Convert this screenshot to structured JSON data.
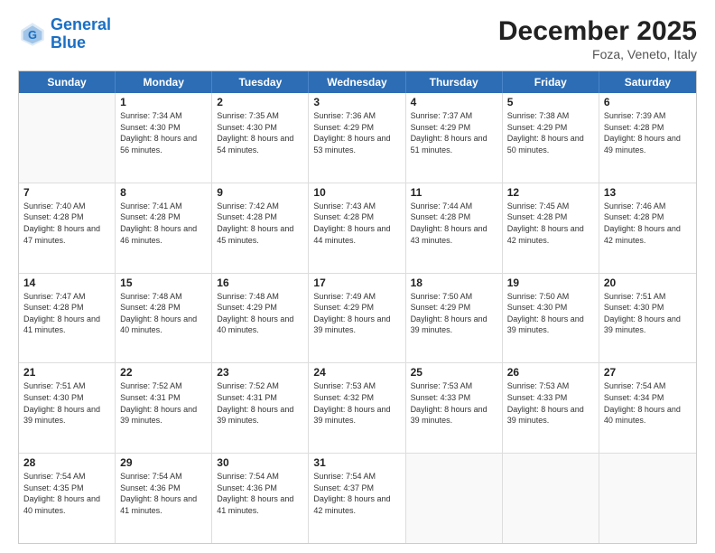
{
  "header": {
    "logo_line1": "General",
    "logo_line2": "Blue",
    "main_title": "December 2025",
    "subtitle": "Foza, Veneto, Italy"
  },
  "day_headers": [
    "Sunday",
    "Monday",
    "Tuesday",
    "Wednesday",
    "Thursday",
    "Friday",
    "Saturday"
  ],
  "rows": [
    [
      {
        "day": "",
        "empty": true
      },
      {
        "day": "1",
        "sunrise": "Sunrise: 7:34 AM",
        "sunset": "Sunset: 4:30 PM",
        "daylight": "Daylight: 8 hours and 56 minutes."
      },
      {
        "day": "2",
        "sunrise": "Sunrise: 7:35 AM",
        "sunset": "Sunset: 4:30 PM",
        "daylight": "Daylight: 8 hours and 54 minutes."
      },
      {
        "day": "3",
        "sunrise": "Sunrise: 7:36 AM",
        "sunset": "Sunset: 4:29 PM",
        "daylight": "Daylight: 8 hours and 53 minutes."
      },
      {
        "day": "4",
        "sunrise": "Sunrise: 7:37 AM",
        "sunset": "Sunset: 4:29 PM",
        "daylight": "Daylight: 8 hours and 51 minutes."
      },
      {
        "day": "5",
        "sunrise": "Sunrise: 7:38 AM",
        "sunset": "Sunset: 4:29 PM",
        "daylight": "Daylight: 8 hours and 50 minutes."
      },
      {
        "day": "6",
        "sunrise": "Sunrise: 7:39 AM",
        "sunset": "Sunset: 4:28 PM",
        "daylight": "Daylight: 8 hours and 49 minutes."
      }
    ],
    [
      {
        "day": "7",
        "sunrise": "Sunrise: 7:40 AM",
        "sunset": "Sunset: 4:28 PM",
        "daylight": "Daylight: 8 hours and 47 minutes."
      },
      {
        "day": "8",
        "sunrise": "Sunrise: 7:41 AM",
        "sunset": "Sunset: 4:28 PM",
        "daylight": "Daylight: 8 hours and 46 minutes."
      },
      {
        "day": "9",
        "sunrise": "Sunrise: 7:42 AM",
        "sunset": "Sunset: 4:28 PM",
        "daylight": "Daylight: 8 hours and 45 minutes."
      },
      {
        "day": "10",
        "sunrise": "Sunrise: 7:43 AM",
        "sunset": "Sunset: 4:28 PM",
        "daylight": "Daylight: 8 hours and 44 minutes."
      },
      {
        "day": "11",
        "sunrise": "Sunrise: 7:44 AM",
        "sunset": "Sunset: 4:28 PM",
        "daylight": "Daylight: 8 hours and 43 minutes."
      },
      {
        "day": "12",
        "sunrise": "Sunrise: 7:45 AM",
        "sunset": "Sunset: 4:28 PM",
        "daylight": "Daylight: 8 hours and 42 minutes."
      },
      {
        "day": "13",
        "sunrise": "Sunrise: 7:46 AM",
        "sunset": "Sunset: 4:28 PM",
        "daylight": "Daylight: 8 hours and 42 minutes."
      }
    ],
    [
      {
        "day": "14",
        "sunrise": "Sunrise: 7:47 AM",
        "sunset": "Sunset: 4:28 PM",
        "daylight": "Daylight: 8 hours and 41 minutes."
      },
      {
        "day": "15",
        "sunrise": "Sunrise: 7:48 AM",
        "sunset": "Sunset: 4:28 PM",
        "daylight": "Daylight: 8 hours and 40 minutes."
      },
      {
        "day": "16",
        "sunrise": "Sunrise: 7:48 AM",
        "sunset": "Sunset: 4:29 PM",
        "daylight": "Daylight: 8 hours and 40 minutes."
      },
      {
        "day": "17",
        "sunrise": "Sunrise: 7:49 AM",
        "sunset": "Sunset: 4:29 PM",
        "daylight": "Daylight: 8 hours and 39 minutes."
      },
      {
        "day": "18",
        "sunrise": "Sunrise: 7:50 AM",
        "sunset": "Sunset: 4:29 PM",
        "daylight": "Daylight: 8 hours and 39 minutes."
      },
      {
        "day": "19",
        "sunrise": "Sunrise: 7:50 AM",
        "sunset": "Sunset: 4:30 PM",
        "daylight": "Daylight: 8 hours and 39 minutes."
      },
      {
        "day": "20",
        "sunrise": "Sunrise: 7:51 AM",
        "sunset": "Sunset: 4:30 PM",
        "daylight": "Daylight: 8 hours and 39 minutes."
      }
    ],
    [
      {
        "day": "21",
        "sunrise": "Sunrise: 7:51 AM",
        "sunset": "Sunset: 4:30 PM",
        "daylight": "Daylight: 8 hours and 39 minutes."
      },
      {
        "day": "22",
        "sunrise": "Sunrise: 7:52 AM",
        "sunset": "Sunset: 4:31 PM",
        "daylight": "Daylight: 8 hours and 39 minutes."
      },
      {
        "day": "23",
        "sunrise": "Sunrise: 7:52 AM",
        "sunset": "Sunset: 4:31 PM",
        "daylight": "Daylight: 8 hours and 39 minutes."
      },
      {
        "day": "24",
        "sunrise": "Sunrise: 7:53 AM",
        "sunset": "Sunset: 4:32 PM",
        "daylight": "Daylight: 8 hours and 39 minutes."
      },
      {
        "day": "25",
        "sunrise": "Sunrise: 7:53 AM",
        "sunset": "Sunset: 4:33 PM",
        "daylight": "Daylight: 8 hours and 39 minutes."
      },
      {
        "day": "26",
        "sunrise": "Sunrise: 7:53 AM",
        "sunset": "Sunset: 4:33 PM",
        "daylight": "Daylight: 8 hours and 39 minutes."
      },
      {
        "day": "27",
        "sunrise": "Sunrise: 7:54 AM",
        "sunset": "Sunset: 4:34 PM",
        "daylight": "Daylight: 8 hours and 40 minutes."
      }
    ],
    [
      {
        "day": "28",
        "sunrise": "Sunrise: 7:54 AM",
        "sunset": "Sunset: 4:35 PM",
        "daylight": "Daylight: 8 hours and 40 minutes."
      },
      {
        "day": "29",
        "sunrise": "Sunrise: 7:54 AM",
        "sunset": "Sunset: 4:36 PM",
        "daylight": "Daylight: 8 hours and 41 minutes."
      },
      {
        "day": "30",
        "sunrise": "Sunrise: 7:54 AM",
        "sunset": "Sunset: 4:36 PM",
        "daylight": "Daylight: 8 hours and 41 minutes."
      },
      {
        "day": "31",
        "sunrise": "Sunrise: 7:54 AM",
        "sunset": "Sunset: 4:37 PM",
        "daylight": "Daylight: 8 hours and 42 minutes."
      },
      {
        "day": "",
        "empty": true
      },
      {
        "day": "",
        "empty": true
      },
      {
        "day": "",
        "empty": true
      }
    ]
  ]
}
